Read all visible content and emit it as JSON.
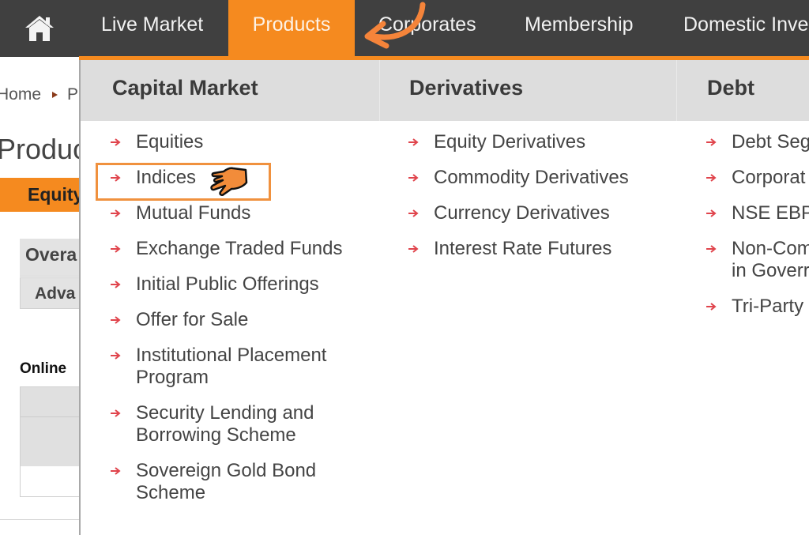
{
  "nav": {
    "home_icon": "home-icon",
    "items": [
      {
        "label": "Live Market",
        "active": false
      },
      {
        "label": "Products",
        "active": true
      },
      {
        "label": "Corporates",
        "active": false
      },
      {
        "label": "Membership",
        "active": false
      },
      {
        "label": "Domestic Inve",
        "active": false
      }
    ]
  },
  "page": {
    "breadcrumb": [
      "Home",
      "P"
    ],
    "title": "Produc",
    "equity_tab": "Equity",
    "overall_tab": "Overa",
    "advanced_tab": "Adva",
    "online_label": "Online"
  },
  "menu": {
    "columns": [
      {
        "title": "Capital Market",
        "items": [
          "Equities",
          "Indices",
          "Mutual Funds",
          "Exchange Traded Funds",
          "Initial Public Offerings",
          "Offer for Sale",
          "Institutional Placement\nProgram",
          "Security Lending and\nBorrowing Scheme",
          "Sovereign Gold Bond\nScheme"
        ]
      },
      {
        "title": "Derivatives",
        "items": [
          "Equity Derivatives",
          "Commodity Derivatives",
          "Currency Derivatives",
          "Interest Rate Futures"
        ]
      },
      {
        "title": "Debt",
        "items": [
          "Debt Seg",
          "Corporat",
          "NSE EBP",
          "Non-Com\nin Goverr",
          "Tri-Party"
        ]
      }
    ],
    "highlighted_item": "Indices"
  },
  "colors": {
    "accent": "#f58a1f",
    "nav_bg": "#404040",
    "menu_header_bg": "#dddddd",
    "bullet_arrow": "#e0444c"
  }
}
